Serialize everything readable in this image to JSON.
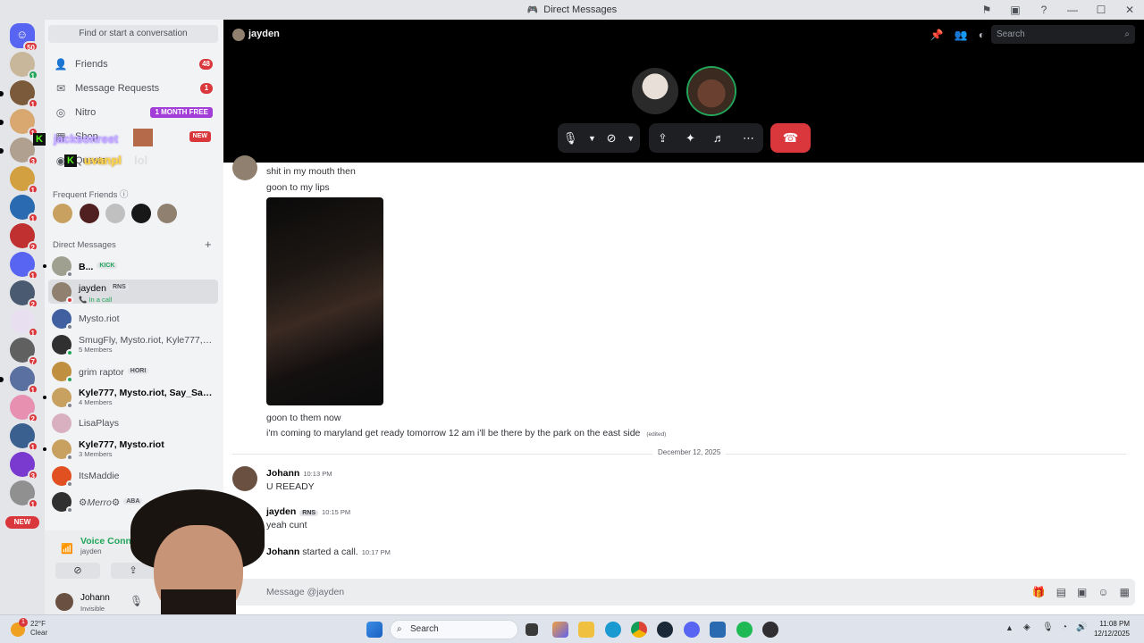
{
  "window": {
    "title": "Direct Messages"
  },
  "dm_sidebar": {
    "find_placeholder": "Find or start a conversation",
    "nav": [
      {
        "label": "Friends",
        "count": "48",
        "icon": "friends-icon"
      },
      {
        "label": "Message Requests",
        "count": "1",
        "icon": "envelope-icon"
      },
      {
        "label": "Nitro",
        "tag": "1 MONTH FREE",
        "icon": "nitro-icon"
      },
      {
        "label": "Shop",
        "tag": "NEW",
        "icon": "shop-icon"
      },
      {
        "label": "Quests",
        "icon": "quests-icon"
      }
    ],
    "overlay_text_1": "jacksonreet",
    "overlay_text_2": "uvanpl",
    "overlay_text_3": "lol",
    "frequent_friends_label": "Frequent Friends",
    "direct_messages_label": "Direct Messages",
    "dms": [
      {
        "name": "B...",
        "tag": "KICK",
        "sub": ""
      },
      {
        "name": "jayden",
        "tag": "RNS",
        "sub": "In a call"
      },
      {
        "name": "Mysto.riot",
        "tag": "",
        "sub": ""
      },
      {
        "name": "SmugFly, Mysto.riot, Kyle777, ...",
        "tag": "",
        "sub": "5 Members"
      },
      {
        "name": "grim raptor",
        "tag": "HORI",
        "sub": ""
      },
      {
        "name": "Kyle777, Mysto.riot, Say_Say1...",
        "tag": "",
        "sub": "4 Members"
      },
      {
        "name": "LisaPlays",
        "tag": "",
        "sub": ""
      },
      {
        "name": "Kyle777, Mysto.riot",
        "tag": "",
        "sub": "3 Members"
      },
      {
        "name": "ItsMaddie",
        "tag": "",
        "sub": ""
      },
      {
        "name": "⚙Merro⚙",
        "tag": "ABA",
        "sub": ""
      }
    ],
    "voice": {
      "status": "Voice Connected",
      "channel": "jayden"
    },
    "user": {
      "name": "Johann",
      "status": "Invisible"
    }
  },
  "servers": {
    "home_badge": "50",
    "new_label": "NEW",
    "badges": [
      "1",
      "1",
      "1",
      "3",
      "1",
      "1",
      "2",
      "1",
      "2",
      "1",
      "7",
      "1",
      "2",
      "1",
      "3",
      "1"
    ]
  },
  "call": {
    "channel_name": "jayden",
    "search_placeholder": "Search"
  },
  "messages": {
    "lines_top": [
      "shit in my mouth then",
      "goon to my lips"
    ],
    "lines_after_image": [
      "goon to them now",
      "i'm coming to maryland get ready tomorrow 12 am i'll be there by the park on the east side"
    ],
    "edited_label": "(edited)",
    "date_divider": "December 12, 2025",
    "m1": {
      "author": "Johann",
      "time": "10:13 PM",
      "text": "U REEADY"
    },
    "m2": {
      "author": "jayden",
      "tag": "RNS",
      "time": "10:15 PM",
      "text": "yeah cunt"
    },
    "m3": {
      "author": "Johann",
      "action": "started a call.",
      "time": "10:17 PM"
    },
    "composer_placeholder": "Message @jayden"
  },
  "taskbar": {
    "weather_temp": "22°F",
    "weather_desc": "Clear",
    "weather_badge": "1",
    "search_label": "Search",
    "time": "11:08 PM",
    "date": "12/12/2025"
  },
  "colors": {
    "accent": "#5865f2",
    "danger": "#da373c",
    "online": "#23a55a",
    "nitro": "#a33dd8"
  }
}
